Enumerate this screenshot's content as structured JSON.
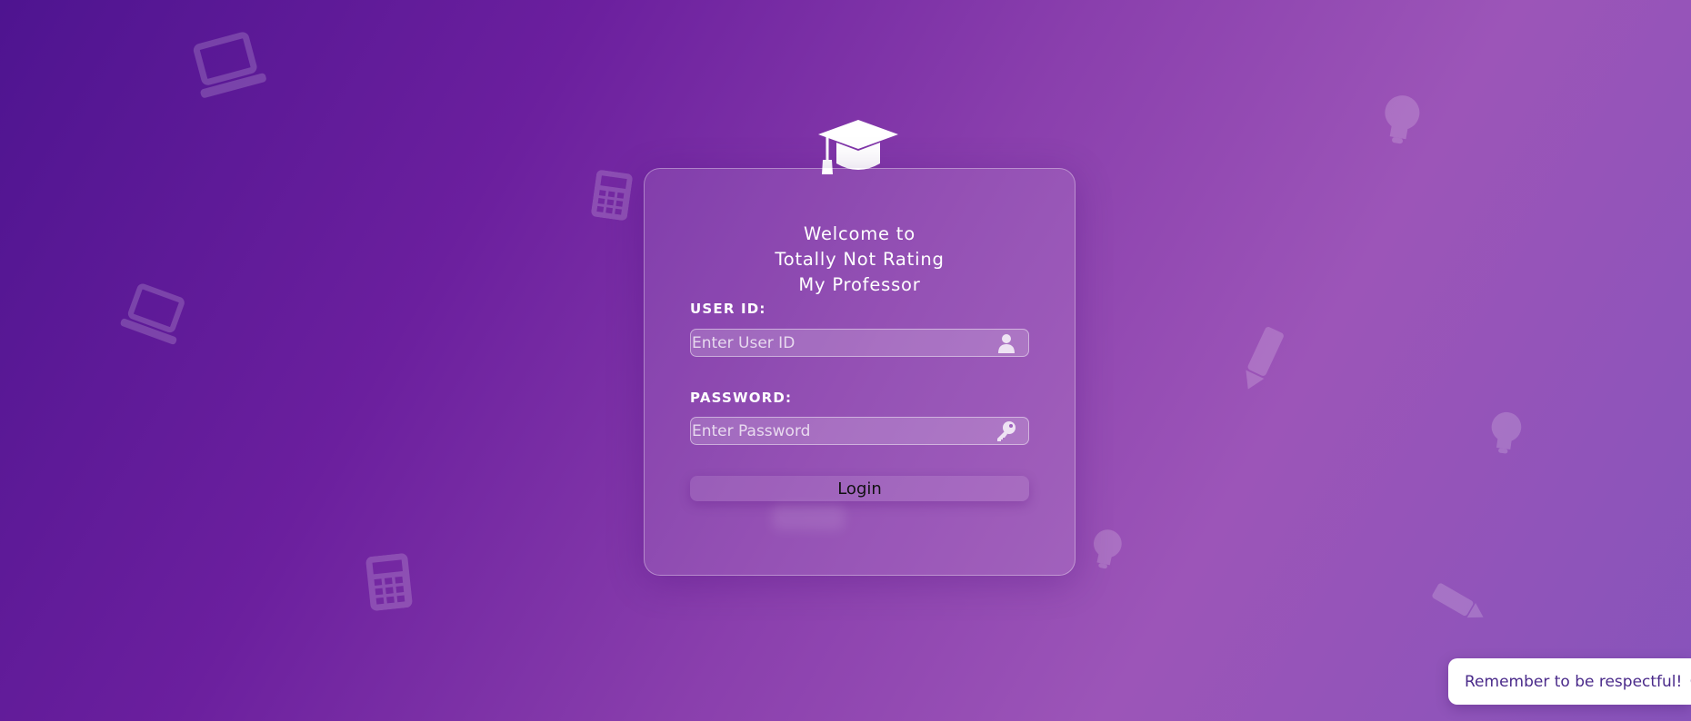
{
  "card": {
    "title_lines": [
      "Welcome to",
      "Totally Not Rating",
      "My Professor"
    ],
    "user_id_label": "USER ID:",
    "user_id_placeholder": "Enter User ID",
    "password_label": "PASSWORD:",
    "password_placeholder": "Enter Password",
    "login_label": "Login"
  },
  "toast": {
    "text": "Remember to be respectful!",
    "emoji": "😀"
  },
  "icons": {
    "logo": "graduation-cap-icon",
    "user_field": "user-icon",
    "password_field": "key-icon",
    "background": [
      "laptop-icon",
      "calculator-icon",
      "lightbulb-icon",
      "pencil-icon"
    ]
  },
  "colors": {
    "gradient_start": "#4e1490",
    "gradient_end": "#9c55b8",
    "toast_text": "#4a2a8a"
  }
}
